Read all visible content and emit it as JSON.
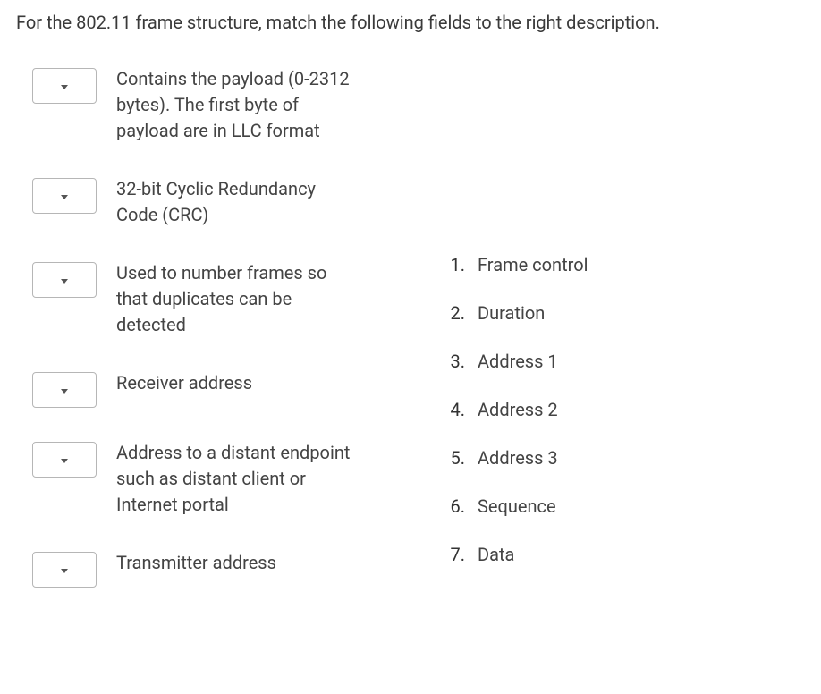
{
  "question": "For the 802.11 frame structure, match the following fields to the right description.",
  "descriptions": [
    "Contains the payload (0-2312 bytes). The first byte of payload are in LLC format",
    "32-bit Cyclic Redundancy Code (CRC)",
    "Used to number frames so that duplicates can be detected",
    "Receiver address",
    "Address to a distant endpoint such as distant client or Internet portal",
    "Transmitter address"
  ],
  "answers": [
    {
      "num": "1.",
      "text": "Frame control"
    },
    {
      "num": "2.",
      "text": "Duration"
    },
    {
      "num": "3.",
      "text": "Address 1"
    },
    {
      "num": "4.",
      "text": "Address 2"
    },
    {
      "num": "5.",
      "text": "Address 3"
    },
    {
      "num": "6.",
      "text": "Sequence"
    },
    {
      "num": "7.",
      "text": "Data"
    }
  ]
}
